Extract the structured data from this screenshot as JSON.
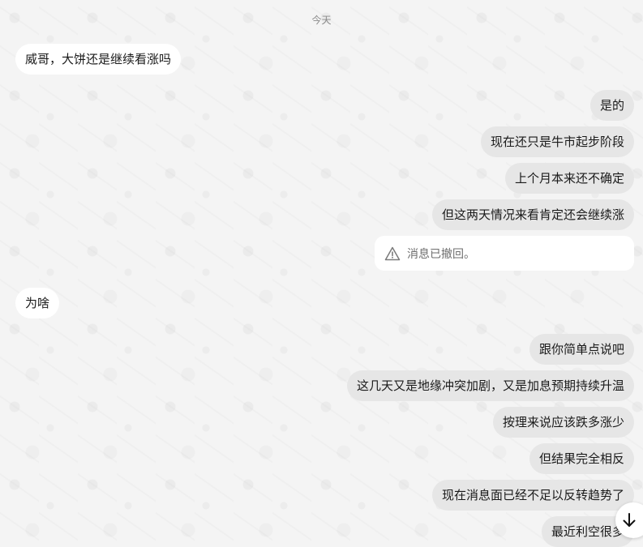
{
  "date_divider": "今天",
  "messages": [
    {
      "side": "incoming",
      "text": "威哥，大饼还是继续看涨吗"
    },
    {
      "side": "outgoing",
      "text": "是的"
    },
    {
      "side": "outgoing",
      "text": "现在还只是牛市起步阶段"
    },
    {
      "side": "outgoing",
      "text": "上个月本来还不确定"
    },
    {
      "side": "outgoing",
      "text": "但这两天情况来看肯定还会继续涨"
    },
    {
      "side": "outgoing",
      "type": "recalled",
      "text": "消息已撤回。",
      "icon": "warning-triangle-icon"
    },
    {
      "side": "incoming",
      "text": "为啥"
    },
    {
      "side": "outgoing",
      "text": "跟你简单点说吧"
    },
    {
      "side": "outgoing",
      "text": "这几天又是地缘冲突加剧，又是加息预期持续升温"
    },
    {
      "side": "outgoing",
      "text": "按理来说应该跌多涨少"
    },
    {
      "side": "outgoing",
      "text": "但结果完全相反"
    },
    {
      "side": "outgoing",
      "text": "现在消息面已经不足以反转趋势了"
    },
    {
      "side": "outgoing",
      "text": "最近利空很多"
    }
  ],
  "scroll_button": {
    "icon": "arrow-down-icon"
  },
  "colors": {
    "background": "#f4f4f4",
    "incoming_bubble": "#ffffff",
    "outgoing_bubble": "#e6e6e6",
    "text": "#1a1a1a",
    "muted_text": "#8a8a8a"
  }
}
